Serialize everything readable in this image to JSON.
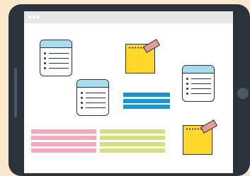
{
  "colors": {
    "background": "#fbe8cc",
    "tablet_frame": "#2a333b",
    "screen": "#ffffff",
    "title_bar": "#e7e7e7",
    "note_header": "#a8dcef",
    "sticky_note": "#ffd829",
    "tape": "#e89a96",
    "bars_blue": "#1596d8",
    "bars_pink": "#f6a9bc",
    "bars_green": "#d4e07e"
  },
  "icons": {
    "window_controls": [
      "dot",
      "dot",
      "dot"
    ],
    "tablet_home_button": "circle-button",
    "checklist_notes": 3,
    "sticky_notes": 2
  }
}
